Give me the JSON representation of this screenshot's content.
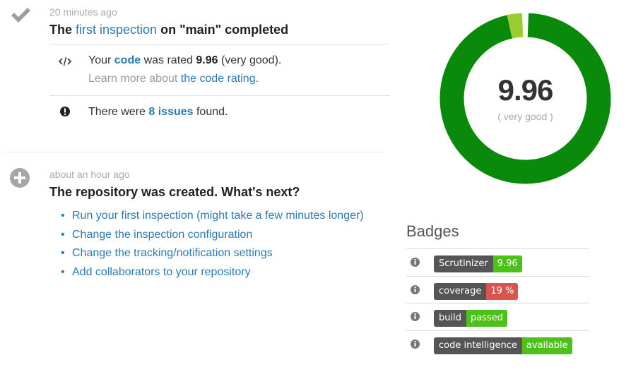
{
  "events": [
    {
      "time": "20 minutes ago",
      "title_prefix": "The ",
      "title_link": "first inspection",
      "title_suffix": " on \"main\" completed",
      "rating": {
        "prefix": "Your ",
        "link": "code",
        "middle": " was rated ",
        "score": "9.96",
        "suffix": " (very good)."
      },
      "learn_more": {
        "prefix": "Learn more about ",
        "link": "the code rating."
      },
      "issues": {
        "prefix": "There were ",
        "link": "8 issues",
        "suffix": " found."
      }
    },
    {
      "time": "about an hour ago",
      "title": "The repository was created. What's next?",
      "next_steps": [
        "Run your first inspection (might take a few minutes longer)",
        "Change the inspection configuration",
        "Change the tracking/notification settings",
        "Add collaborators to your repository"
      ]
    }
  ],
  "score": {
    "value": "9.96",
    "label": "( very good )",
    "ring_fraction_green": 0.965,
    "colors": {
      "good": "#0a8a0a",
      "light": "#9acd32",
      "gap": "#ffffff"
    }
  },
  "badges": {
    "title": "Badges",
    "items": [
      {
        "key": "Scrutinizer",
        "value": "9.96",
        "color": "#4cc11a"
      },
      {
        "key": "coverage",
        "value": "19 %",
        "color": "#d9534f"
      },
      {
        "key": "build",
        "value": "passed",
        "color": "#4cc11a"
      },
      {
        "key": "code intelligence",
        "value": "available",
        "color": "#4cc11a"
      }
    ]
  }
}
